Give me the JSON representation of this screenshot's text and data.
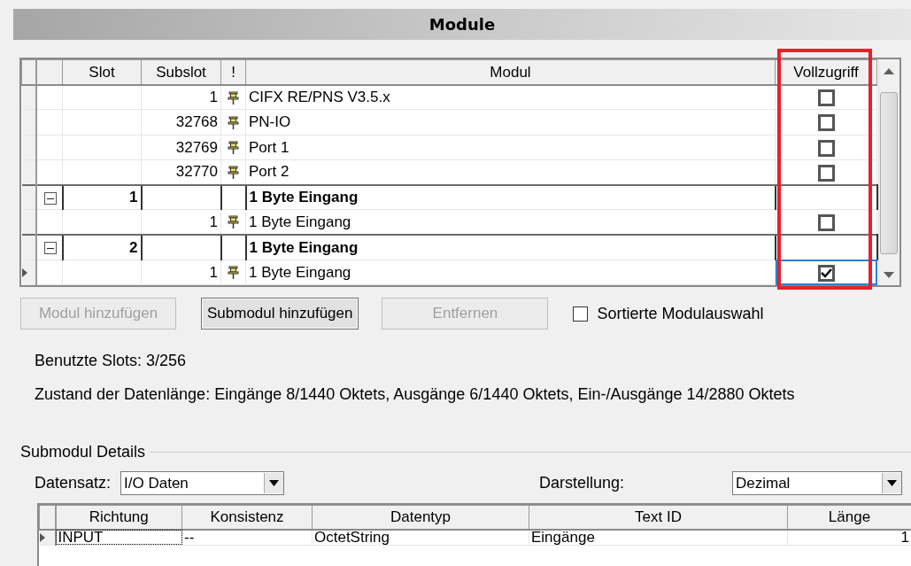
{
  "title": "Module",
  "modules_grid": {
    "columns": [
      {
        "label": "Slot"
      },
      {
        "label": "Subslot"
      },
      {
        "label": "!"
      },
      {
        "label": "Modul"
      },
      {
        "label": "Vollzugriff",
        "highlighted": true
      }
    ],
    "rows": [
      {
        "kind": "submodule",
        "slot": "",
        "subslot": "1",
        "modul": "CIFX RE/PNS V3.5.x",
        "checked": false,
        "current": false
      },
      {
        "kind": "submodule",
        "slot": "",
        "subslot": "32768",
        "modul": "PN-IO",
        "checked": false,
        "current": false
      },
      {
        "kind": "submodule",
        "slot": "",
        "subslot": "32769",
        "modul": "Port 1",
        "checked": false,
        "current": false
      },
      {
        "kind": "submodule",
        "slot": "",
        "subslot": "32770",
        "modul": "Port 2",
        "checked": false,
        "current": false
      },
      {
        "kind": "module",
        "slot": "1",
        "subslot": "",
        "modul": "1 Byte Eingang",
        "expanded": true,
        "current": false
      },
      {
        "kind": "submodule",
        "slot": "",
        "subslot": "1",
        "modul": "1 Byte Eingang",
        "checked": false,
        "current": false
      },
      {
        "kind": "module",
        "slot": "2",
        "subslot": "",
        "modul": "1 Byte Eingang",
        "expanded": true,
        "current": false
      },
      {
        "kind": "submodule",
        "slot": "",
        "subslot": "1",
        "modul": "1 Byte Eingang",
        "checked": true,
        "current": true
      }
    ]
  },
  "buttons": [
    {
      "label": "Modul hinzufügen",
      "disabled": true
    },
    {
      "label": "Submodul hinzufügen",
      "disabled": false
    },
    {
      "label": "Entfernen",
      "disabled": true
    }
  ],
  "sorted_selection": {
    "label": "Sortierte Modulauswahl",
    "checked": false
  },
  "used_slots": "Benutzte Slots: 3/256",
  "data_length": "Zustand der Datenlänge: Eingänge 8/1440 Oktets, Ausgänge 6/1440 Oktets, Ein-/Ausgänge 14/2880 Oktets",
  "details": {
    "title": "Submodul Details",
    "dataset": {
      "label": "Datensatz:",
      "value": "I/O Daten"
    },
    "display": {
      "label": "Darstellung:",
      "value": "Dezimal"
    },
    "columns": [
      "Richtung",
      "Konsistenz",
      "Datentyp",
      "Text ID",
      "Länge"
    ],
    "rows": [
      {
        "cells": [
          "INPUT",
          "--",
          "OctetString",
          "Eingänge",
          "1"
        ],
        "current": true
      }
    ]
  }
}
